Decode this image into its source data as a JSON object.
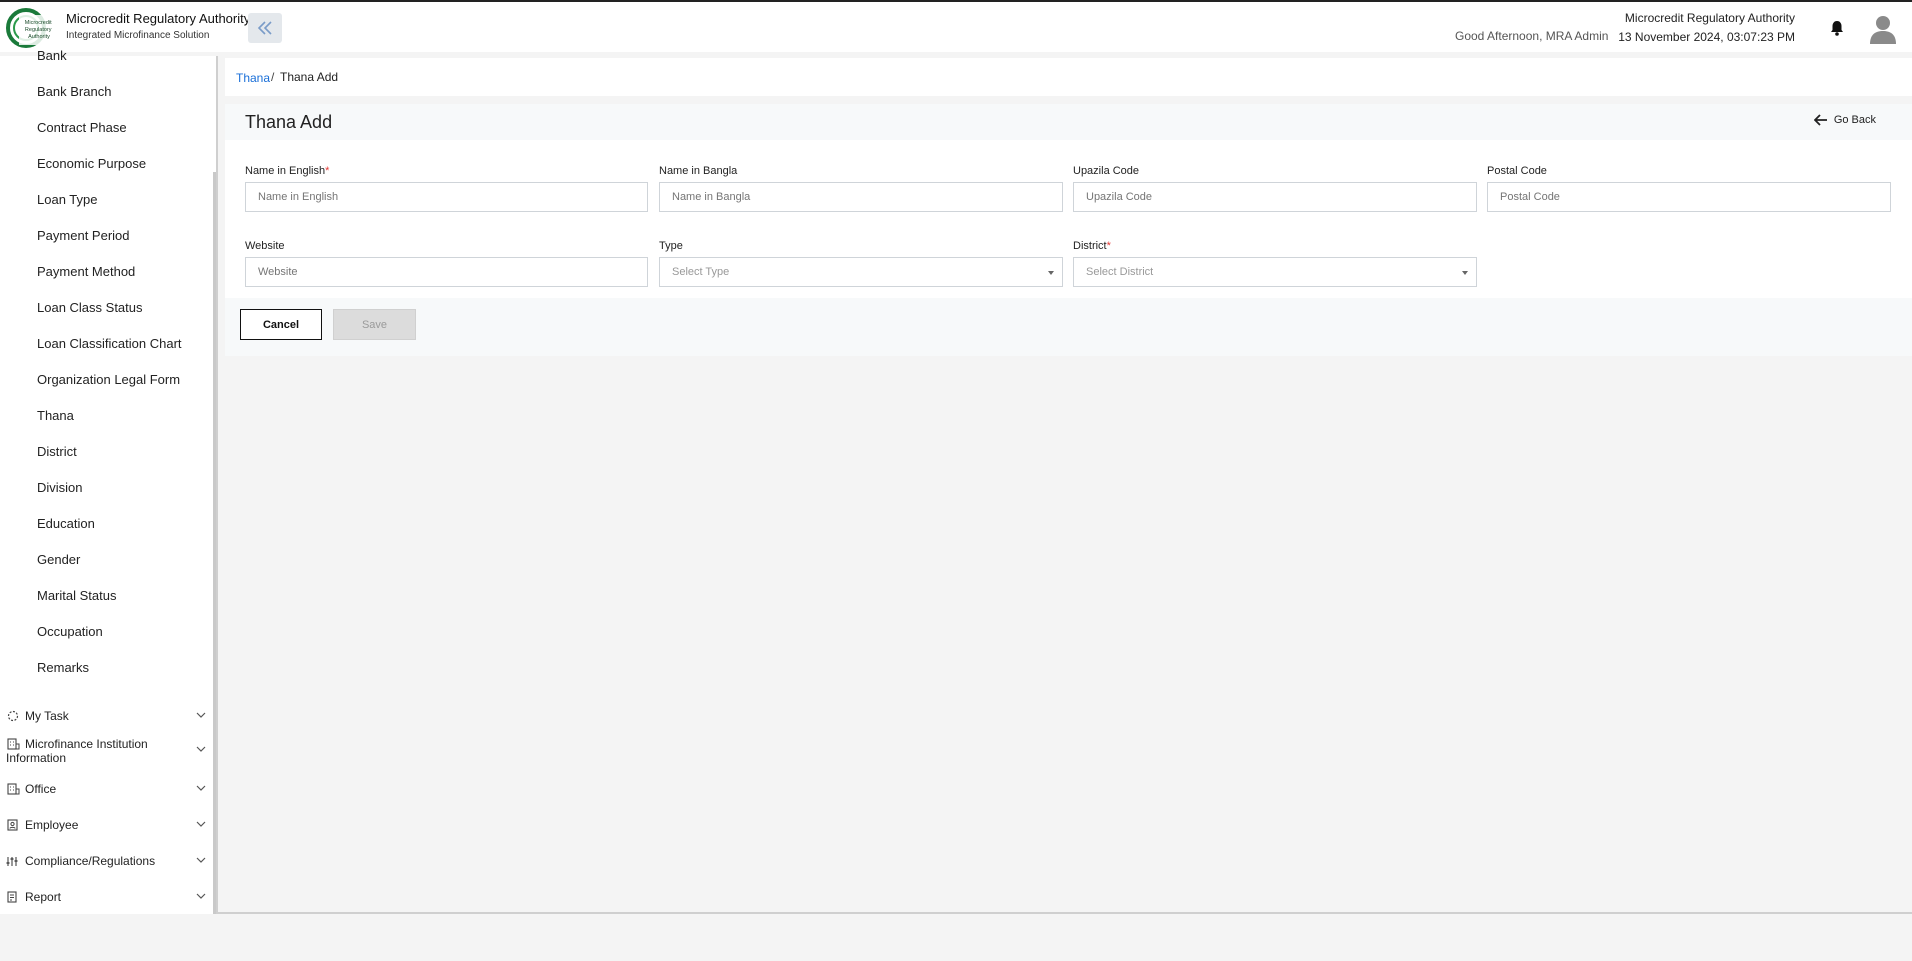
{
  "header": {
    "brand_title": "Microcredit Regulatory Authority",
    "brand_subtitle": "Integrated Microfinance Solution",
    "logo_text": "Microcredit Regulatory Authority",
    "greeting": "Good Afternoon, MRA Admin",
    "org_name": "Microcredit Regulatory Authority",
    "datetime": "13 November 2024, 03:07:23 PM",
    "accent_color": "#1a7a3a"
  },
  "sidebar": {
    "sub_items": [
      "Bank",
      "Bank Branch",
      "Contract Phase",
      "Economic Purpose",
      "Loan Type",
      "Payment Period",
      "Payment Method",
      "Loan Class Status",
      "Loan Classification Chart",
      "Organization Legal Form",
      "Thana",
      "District",
      "Division",
      "Education",
      "Gender",
      "Marital Status",
      "Occupation",
      "Remarks"
    ],
    "groups": [
      {
        "label": "My Task",
        "icon": "task-icon"
      },
      {
        "label": "Microfinance Institution Information",
        "icon": "building-icon"
      },
      {
        "label": "Office",
        "icon": "building-icon"
      },
      {
        "label": "Employee",
        "icon": "employee-icon"
      },
      {
        "label": "Compliance/Regulations",
        "icon": "sliders-icon"
      },
      {
        "label": "Report",
        "icon": "report-icon"
      }
    ]
  },
  "breadcrumb": {
    "link": "Thana",
    "separator": "/",
    "current": "Thana Add"
  },
  "form": {
    "title": "Thana Add",
    "go_back": "Go Back",
    "fields": {
      "name_en": {
        "label": "Name in English",
        "required": "*",
        "placeholder": "Name in English",
        "value": ""
      },
      "name_bn": {
        "label": "Name in Bangla",
        "placeholder": "Name in Bangla",
        "value": ""
      },
      "upazila": {
        "label": "Upazila Code",
        "placeholder": "Upazila Code",
        "value": ""
      },
      "postal": {
        "label": "Postal Code",
        "placeholder": "Postal Code",
        "value": ""
      },
      "website": {
        "label": "Website",
        "placeholder": "Website",
        "value": ""
      },
      "type": {
        "label": "Type",
        "placeholder": "Select Type"
      },
      "district": {
        "label": "District",
        "required": "*",
        "placeholder": "Select District"
      }
    },
    "cancel_label": "Cancel",
    "save_label": "Save"
  }
}
